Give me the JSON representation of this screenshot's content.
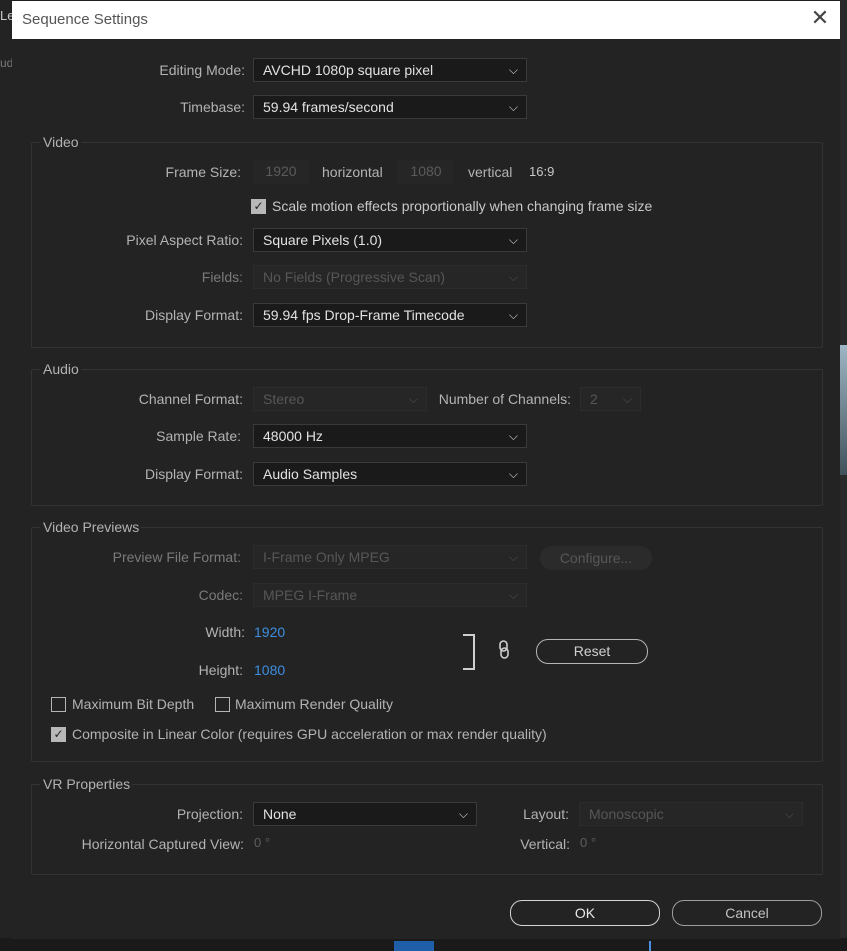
{
  "background": {
    "left_text": "Le",
    "left_text2": "ud"
  },
  "dialog": {
    "title": "Sequence Settings",
    "close_symbol": "✕"
  },
  "top": {
    "editing_mode_label": "Editing Mode:",
    "editing_mode_value": "AVCHD 1080p square pixel",
    "timebase_label": "Timebase:",
    "timebase_value": "59.94  frames/second"
  },
  "video": {
    "section": "Video",
    "frame_size_label": "Frame Size:",
    "frame_width": "1920",
    "horizontal_label": "horizontal",
    "frame_height": "1080",
    "vertical_label": "vertical",
    "aspect": "16:9",
    "scale_motion_label": "Scale motion effects proportionally when changing frame size",
    "scale_motion_checked": true,
    "pixel_aspect_label": "Pixel Aspect Ratio:",
    "pixel_aspect_value": "Square Pixels (1.0)",
    "fields_label": "Fields:",
    "fields_value": "No Fields (Progressive Scan)",
    "display_format_label": "Display Format:",
    "display_format_value": "59.94 fps Drop-Frame Timecode"
  },
  "audio": {
    "section": "Audio",
    "channel_format_label": "Channel Format:",
    "channel_format_value": "Stereo",
    "num_channels_label": "Number of Channels:",
    "num_channels_value": "2",
    "sample_rate_label": "Sample Rate:",
    "sample_rate_value": "48000 Hz",
    "display_format_label": "Display Format:",
    "display_format_value": "Audio Samples"
  },
  "previews": {
    "section": "Video Previews",
    "file_format_label": "Preview File Format:",
    "file_format_value": "I-Frame Only MPEG",
    "configure_label": "Configure...",
    "codec_label": "Codec:",
    "codec_value": "MPEG I-Frame",
    "width_label": "Width:",
    "width_value": "1920",
    "height_label": "Height:",
    "height_value": "1080",
    "link_icon": "🔗",
    "reset_label": "Reset",
    "max_bit_depth_label": "Maximum Bit Depth",
    "max_render_quality_label": "Maximum Render Quality",
    "composite_label": "Composite in Linear Color (requires GPU acceleration or max render quality)",
    "max_bit_depth_checked": false,
    "max_render_quality_checked": false,
    "composite_checked": true
  },
  "vr": {
    "section": "VR Properties",
    "projection_label": "Projection:",
    "projection_value": "None",
    "layout_label": "Layout:",
    "layout_value": "Monoscopic",
    "h_view_label": "Horizontal Captured View:",
    "h_view_value": "0 °",
    "vertical_label": "Vertical:",
    "vertical_value": "0 °"
  },
  "buttons": {
    "ok": "OK",
    "cancel": "Cancel"
  },
  "icons": {
    "chevron": "⌵",
    "check": "✓"
  }
}
